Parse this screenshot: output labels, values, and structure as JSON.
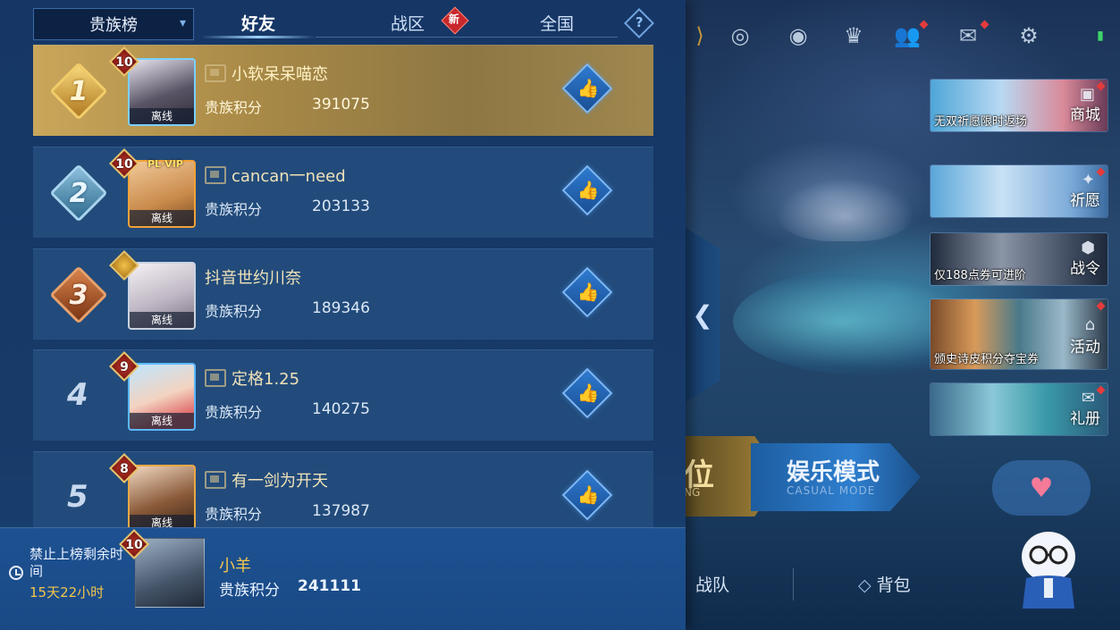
{
  "tabs": {
    "dropdown_label": "贵族榜",
    "friends": "好友",
    "region": "战区",
    "region_badge": "新",
    "national": "全国",
    "help_glyph": "?"
  },
  "rows": [
    {
      "rank": "1",
      "level": "10",
      "name": "小软呆呆喵恋",
      "status": "离线",
      "score_label": "贵族积分",
      "score": "391075",
      "vip": ""
    },
    {
      "rank": "2",
      "level": "10",
      "name": "cancan一need",
      "status": "离线",
      "score_label": "贵族积分",
      "score": "203133",
      "vip": "PL·VIP"
    },
    {
      "rank": "3",
      "level": "",
      "name": "抖音世约川奈",
      "status": "离线",
      "score_label": "贵族积分",
      "score": "189346",
      "vip": ""
    },
    {
      "rank": "4",
      "level": "9",
      "name": "定格1.25",
      "status": "离线",
      "score_label": "贵族积分",
      "score": "140275",
      "vip": ""
    },
    {
      "rank": "5",
      "level": "8",
      "name": "有一剑为开天",
      "status": "离线",
      "score_label": "贵族积分",
      "score": "137987",
      "vip": ""
    }
  ],
  "me": {
    "ban_label": "禁止上榜剩余时间",
    "ban_time": "15天22小时",
    "level": "10",
    "name": "小羊",
    "score_label": "贵族积分",
    "score": "241111"
  },
  "banners": [
    {
      "text": "无双祈愿限时返场",
      "label": "商城"
    },
    {
      "text": "",
      "label": "祈愿"
    },
    {
      "text": "仅188点券可进阶",
      "label": "战令"
    },
    {
      "text": "颁史诗皮积分夺宝券",
      "label": "活动"
    },
    {
      "text": "",
      "label": "礼册"
    }
  ],
  "modes": {
    "rank_big": "位",
    "rank_small": "NG",
    "casual_big": "娱乐模式",
    "casual_small": "CASUAL MODE"
  },
  "bottom_nav": {
    "team": "战队",
    "bag": "背包"
  },
  "colors": {
    "rank1": "#e0b34a",
    "rank2": "#7fb2d6",
    "rank3": "#c9633a",
    "gold_text": "#f3c64a"
  }
}
